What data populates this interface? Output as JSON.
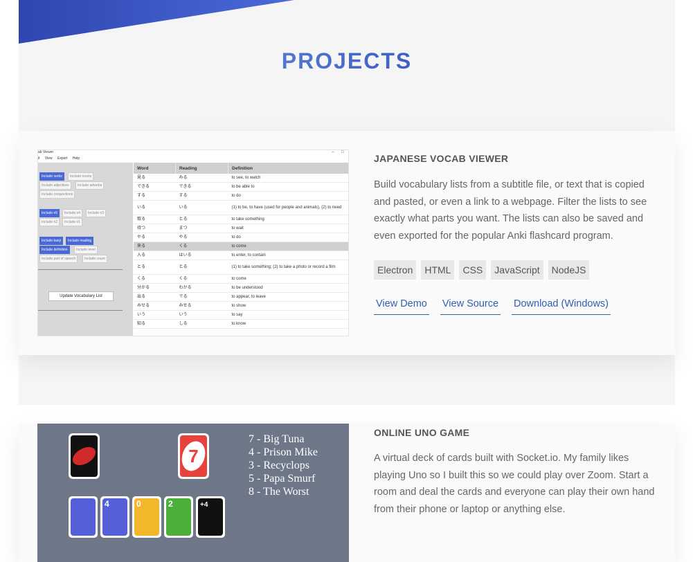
{
  "section": {
    "title": "PROJECTS"
  },
  "colors": {
    "accent": "#2f5fb0",
    "title_start": "#7aa8e0",
    "title_end": "#2b3a9c"
  },
  "projects": [
    {
      "title": "JAPANESE VOCAB VIEWER",
      "description": "Build vocabulary lists from a subtitle file, or text that is copied and pasted, or even a link to a webpage. Filter the lists to see exactly what parts you want. The lists can also be saved and even exported for the popular Anki flashcard program.",
      "tags": [
        "Electron",
        "HTML",
        "CSS",
        "JavaScript",
        "NodeJS"
      ],
      "links": [
        "View Demo",
        "View Source",
        "Download (Windows)"
      ],
      "screenshot": {
        "window_title": "ab Viewer",
        "menu": [
          "it",
          "View",
          "Export",
          "Help"
        ],
        "filters": {
          "row1": [
            "Include verbs",
            "Include nouns"
          ],
          "row2": [
            "Include adjectives",
            "Include adverbs"
          ],
          "row3": [
            "Include conjunctions"
          ],
          "row4": [
            "Include n5",
            "Include n4",
            "Include n3"
          ],
          "row5": [
            "Include n2",
            "Include n1"
          ],
          "row6": [
            "Include kanji",
            "Include reading"
          ],
          "row7": [
            "Include definition",
            "Include level"
          ],
          "row8": [
            "Include part of speech",
            "Include count"
          ]
        },
        "update_button": "Update Vocabulary List",
        "columns": [
          "Word",
          "Reading",
          "Definition"
        ],
        "rows": [
          [
            "見る",
            "みる",
            "to see, to watch"
          ],
          [
            "できる",
            "できる",
            "to be able to"
          ],
          [
            "する",
            "する",
            "to do"
          ],
          [
            "いる",
            "いる",
            "(1) to be, to have (used for people and animals), (2) to need"
          ],
          [
            "取る",
            "とる",
            "to take something"
          ],
          [
            "待つ",
            "まつ",
            "to wait"
          ],
          [
            "やる",
            "やる",
            "to do"
          ],
          [
            "来る",
            "くる",
            "to come"
          ],
          [
            "入る",
            "はいる",
            "to enter, to contain"
          ],
          [
            "とる",
            "とる",
            "(1) to take something; (2) to take a photo or record a film"
          ],
          [
            "くる",
            "くる",
            "to come"
          ],
          [
            "分かる",
            "わかる",
            "to be understood"
          ],
          [
            "出る",
            "でる",
            "to appear, to leave"
          ],
          [
            "みせる",
            "みせる",
            "to show"
          ],
          [
            "いう",
            "いう",
            "to say"
          ],
          [
            "知る",
            "しる",
            "to know"
          ]
        ]
      }
    },
    {
      "title": "ONLINE UNO GAME",
      "description": "A virtual deck of cards built with Socket.io. My family likes playing Uno so I built this so we could play over Zoom. Start a room and deal the cards and everyone can play their own hand from their phone or laptop or anything else.",
      "screenshot": {
        "scores": [
          "7 - Big Tuna",
          "4 - Prison Mike",
          "3 - Recyclops",
          "5 - Papa Smurf",
          "8 - The Worst"
        ],
        "discard_card": "7",
        "hand_cards": [
          "4",
          "0",
          "2",
          "+4"
        ]
      }
    }
  ]
}
